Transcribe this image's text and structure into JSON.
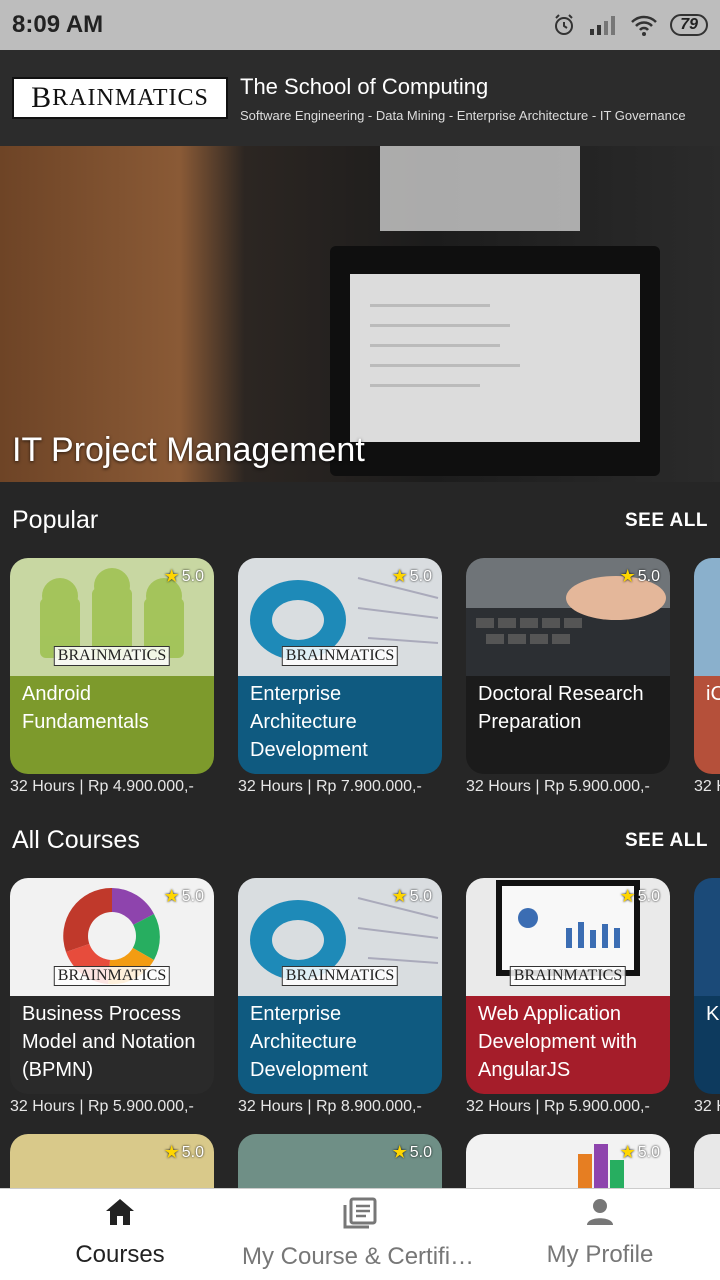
{
  "status": {
    "time": "8:09 AM",
    "battery": "79"
  },
  "header": {
    "logo": {
      "big": "B",
      "part1": "RAIN",
      "part2": "MATICS"
    },
    "title": "The School of Computing",
    "subtitle": "Software Engineering - Data Mining - Enterprise Architecture - IT Governance"
  },
  "hero": {
    "title": "IT Project Management"
  },
  "popular": {
    "title": "Popular",
    "see_all": "SEE ALL",
    "courses": [
      {
        "name": "Android Fundamentals",
        "rating": "5.0",
        "meta": "32 Hours  | Rp 4.900.000,-",
        "color": "#7d9a2c"
      },
      {
        "name": "Enterprise Architecture Development",
        "rating": "5.0",
        "meta": "32 Hours  | Rp 7.900.000,-",
        "color": "#0f5a80"
      },
      {
        "name": "Doctoral Research Preparation",
        "rating": "5.0",
        "meta": "32 Hours  | Rp 5.900.000,-",
        "color": "#1b1b1b"
      },
      {
        "name": "iC D S",
        "rating": "",
        "meta": "32 H",
        "color": "#b5503a"
      }
    ]
  },
  "all_courses": {
    "title": "All Courses",
    "see_all": "SEE ALL",
    "courses": [
      {
        "name": "Business Process Model and Notation (BPMN)",
        "rating": "5.0",
        "meta": "32 Hours  | Rp 5.900.000,-",
        "color": "#2a2a2a"
      },
      {
        "name": "Enterprise Architecture Development",
        "rating": "5.0",
        "meta": "32 Hours  | Rp 8.900.000,-",
        "color": "#0f5a80"
      },
      {
        "name": "Web Application Development with AngularJS",
        "rating": "5.0",
        "meta": "32 Hours  | Rp 5.900.000,-",
        "color": "#a51d2a"
      },
      {
        "name": "Ki M",
        "rating": "",
        "meta": "32 H",
        "color": "#0d3a5e"
      }
    ]
  },
  "more_row": {
    "ratings": [
      "5.0",
      "5.0",
      "5.0"
    ]
  },
  "nav": {
    "courses": "Courses",
    "my_course": "My Course & Certific...",
    "profile": "My Profile"
  }
}
